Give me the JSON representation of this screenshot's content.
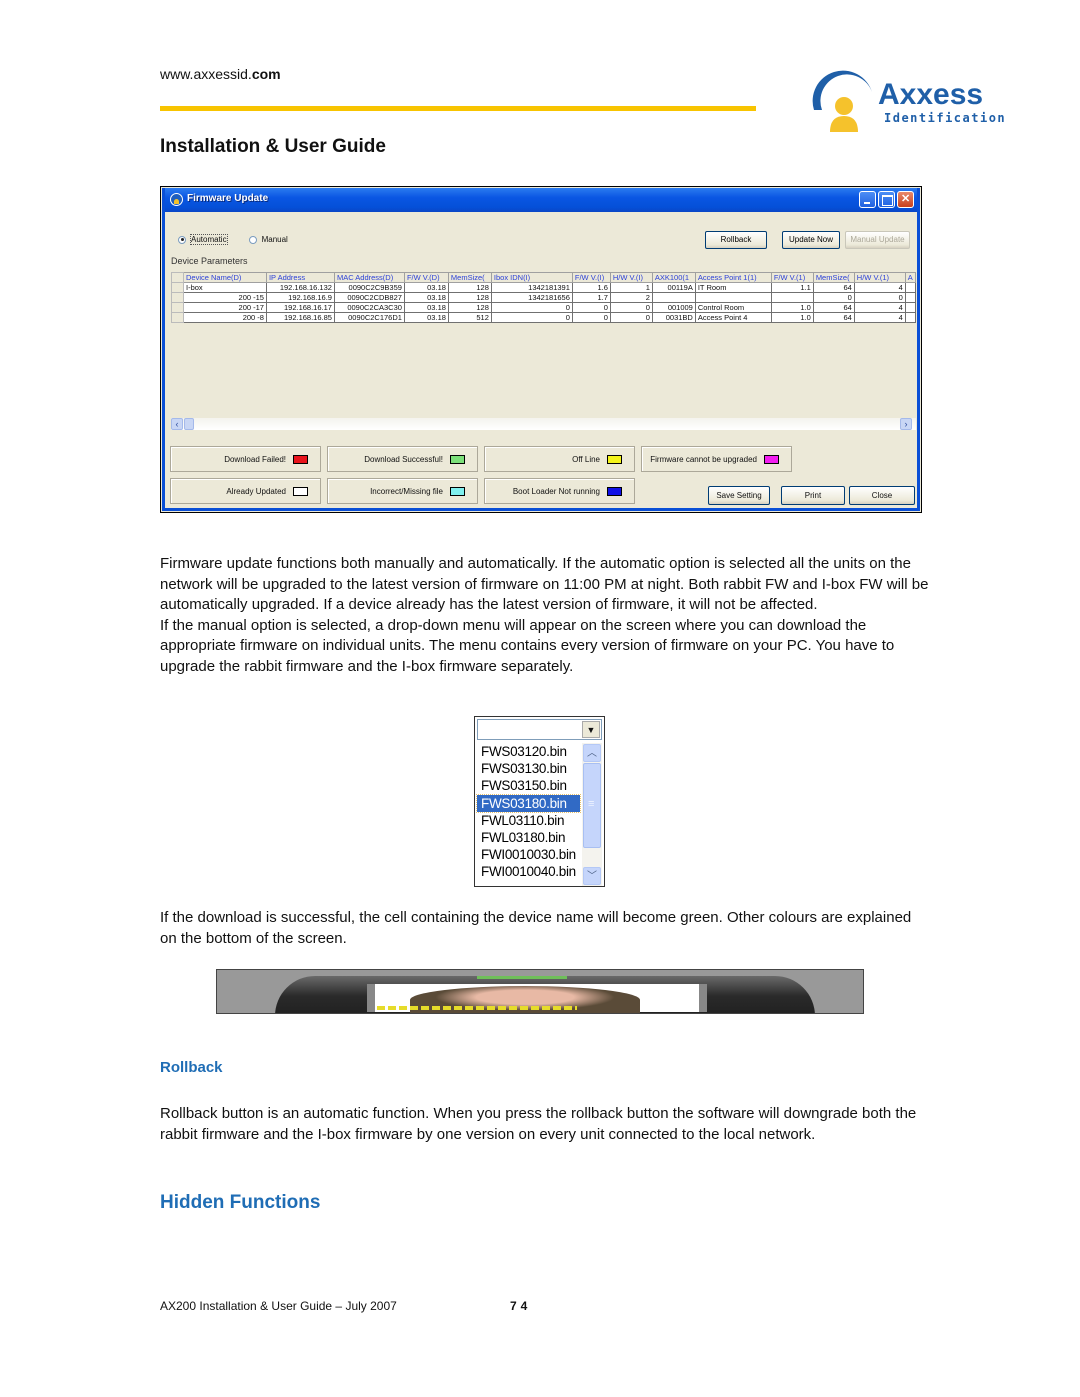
{
  "header": {
    "url_prefix": "www.axxessid.",
    "url_suffix": "com",
    "logo": {
      "name": "Axxess",
      "tagline": "Identification",
      "brand_color": "#1f5fa8",
      "accent_color": "#f5c22c"
    },
    "doc_title": "Installation & User Guide",
    "rule_color": "#f8c400"
  },
  "window": {
    "title": "Firmware Update",
    "mode_options": [
      {
        "label": "Automatic",
        "selected": true
      },
      {
        "label": "Manual",
        "selected": false
      }
    ],
    "section_label": "Device Parameters",
    "buttons": {
      "rollback": "Rollback",
      "update_now": "Update Now",
      "manual_update": "Manual Update"
    },
    "table": {
      "columns": [
        "Device Name(D)",
        "IP Address",
        "MAC Address(D)",
        "F/W V.(D)",
        "MemSize(",
        "Ibox IDN(I)",
        "F/W V.(I)",
        "H/W V.(I)",
        "AXK100(1",
        "Access Point 1(1)",
        "F/W V.(1)",
        "MemSize(",
        "H/W V.(1)",
        "A"
      ],
      "rows": [
        [
          "I-box",
          "192.168.16.132",
          "0090C2C9B359",
          "03.18",
          "128",
          "1342181391",
          "1.6",
          "1",
          "00119A",
          "IT Room",
          "1.1",
          "64",
          "4",
          ""
        ],
        [
          "200 -15",
          "192.168.16.9",
          "0090C2CDB827",
          "03.18",
          "128",
          "1342181656",
          "1.7",
          "2",
          "",
          "",
          "",
          "0",
          "0",
          ""
        ],
        [
          "200 -17",
          "192.168.16.17",
          "0090C2CA3C30",
          "03.18",
          "128",
          "0",
          "0",
          "0",
          "001009",
          "Control Room",
          "1.0",
          "64",
          "4",
          ""
        ],
        [
          "200 -8",
          "192.168.16.85",
          "0090C2C176D1",
          "03.18",
          "512",
          "0",
          "0",
          "0",
          "0031BD",
          "Access Point 4",
          "1.0",
          "64",
          "4",
          ""
        ]
      ]
    },
    "legend": [
      {
        "label": "Download Failed!",
        "color": "#e8141c"
      },
      {
        "label": "Download Successful!",
        "color": "#7ce07a"
      },
      {
        "label": "Off Line",
        "color": "#f4f41a"
      },
      {
        "label": "Firmware cannot be upgraded",
        "color": "#f21ef0"
      },
      {
        "label": "Already Updated",
        "color": "#ffffff"
      },
      {
        "label": "Incorrect/Missing file",
        "color": "#7ff0ee"
      },
      {
        "label": "Boot Loader Not running",
        "color": "#1010e6"
      }
    ],
    "bottom_buttons": {
      "save": "Save Setting",
      "print": "Print",
      "close": "Close"
    }
  },
  "body": {
    "paragraph1": "Firmware update functions both manually and automatically. If the automatic option is selected all the units on the network will be upgraded to the latest version of firmware on 11:00 PM at night. Both rabbit FW and I-box FW will be automatically upgraded. If a device already has the latest version of firmware, it will not be affected.",
    "paragraph2": "If the manual option is selected, a drop-down menu will appear on the screen where you can download the appropriate firmware on individual units. The menu contains every version of firmware on your PC. You have to upgrade the rabbit firmware and the I-box firmware separately.",
    "dropdown": {
      "value": "",
      "items": [
        "FWS03120.bin",
        "FWS03130.bin",
        "FWS03150.bin",
        "FWS03180.bin",
        "FWL03110.bin",
        "FWL03180.bin",
        "FWI0010030.bin",
        "FWI0010040.bin"
      ],
      "selected_index": 3
    },
    "paragraph3": "If the download is successful, the cell containing the device name will become green. Other colours are explained on the bottom of the screen.",
    "rollback_heading": "Rollback",
    "paragraph4": "Rollback button is an automatic function. When you press the rollback button the software will downgrade both the rabbit firmware and the I-box firmware by one version on every unit connected to the local network.",
    "hidden_heading": "Hidden Functions"
  },
  "footer": {
    "text": "AX200 Installation & User Guide – July 2007",
    "page": "74"
  }
}
